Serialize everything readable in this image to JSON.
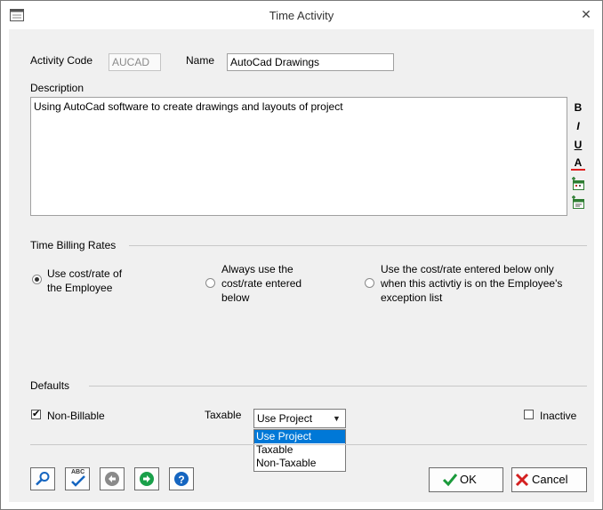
{
  "window": {
    "title": "Time Activity",
    "close_glyph": "✕"
  },
  "activity_code": {
    "label": "Activity Code",
    "value": "AUCAD"
  },
  "name": {
    "label": "Name",
    "value": "AutoCad Drawings"
  },
  "description": {
    "label": "Description",
    "value": "Using AutoCad software to create drawings and layouts of project",
    "format_buttons": [
      "B",
      "I",
      "U",
      "A"
    ]
  },
  "billing": {
    "section_title": "Time Billing Rates",
    "options": [
      {
        "line1": "Use cost/rate of",
        "line2": "the Employee",
        "line3": "",
        "selected": true
      },
      {
        "line1": "Always use the",
        "line2": "cost/rate entered",
        "line3": "below",
        "selected": false
      },
      {
        "line1": "Use the cost/rate entered below only",
        "line2": "when this activtiy is on the Employee's",
        "line3": "exception list",
        "selected": false
      }
    ]
  },
  "defaults": {
    "section_title": "Defaults",
    "non_billable": {
      "label": "Non-Billable",
      "checked": true,
      "mark": "✔"
    },
    "taxable": {
      "label": "Taxable",
      "value": "Use Project",
      "arrow": "▼",
      "options": [
        "Use Project",
        "Taxable",
        "Non-Taxable"
      ],
      "highlighted": "Use Project"
    },
    "inactive": {
      "label": "Inactive",
      "checked": false
    }
  },
  "footer": {
    "ok_label": "OK",
    "cancel_label": "Cancel",
    "icons": [
      "search-icon",
      "spellcheck-icon",
      "back-icon",
      "forward-icon",
      "help-icon"
    ],
    "spell_text": "ABC",
    "help_text": "?"
  },
  "colors": {
    "accent": "#0078d7",
    "ok": "#1a9a3a",
    "cancel": "#d42020",
    "nav_green": "#1aa04a",
    "help_blue": "#1565c0"
  }
}
